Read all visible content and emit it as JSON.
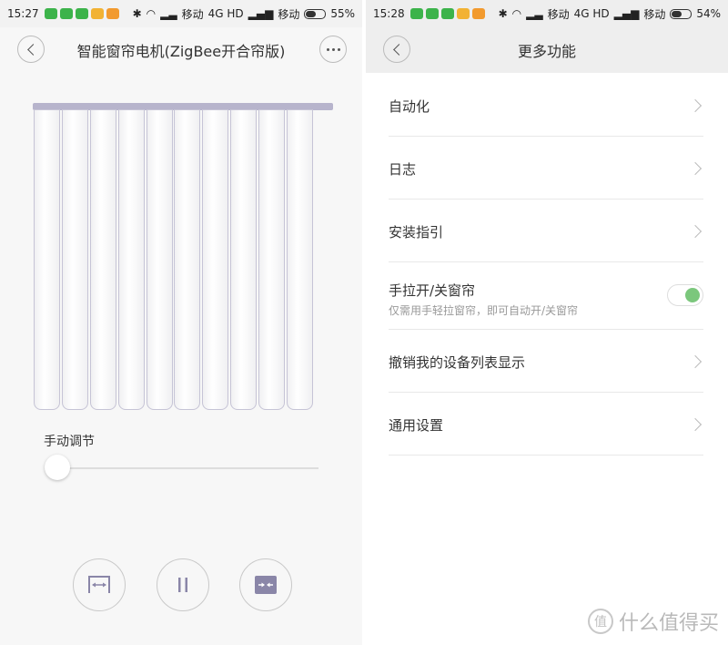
{
  "left": {
    "status_bar": {
      "time": "15:27",
      "carrier1": "移动",
      "network": "4G HD",
      "carrier2": "移动",
      "battery": "55%",
      "battery_level": 0.55
    },
    "nav": {
      "title": "智能窗帘电机(ZigBee开合帘版)"
    },
    "manual_label": "手动调节",
    "slider_value": 0
  },
  "right": {
    "status_bar": {
      "time": "15:28",
      "carrier1": "移动",
      "network": "4G HD",
      "carrier2": "移动",
      "battery": "54%",
      "battery_level": 0.54
    },
    "nav": {
      "title": "更多功能"
    },
    "menu": [
      {
        "label": "自动化"
      },
      {
        "label": "日志"
      },
      {
        "label": "安装指引"
      },
      {
        "label": "手拉开/关窗帘",
        "sub": "仅需用手轻拉窗帘，即可自动开/关窗帘",
        "toggle_on": true
      },
      {
        "label": "撤销我的设备列表显示"
      },
      {
        "label": "通用设置"
      }
    ]
  },
  "watermark": {
    "text": "什么值得买",
    "logo": "值"
  },
  "colors": {
    "accent_green": "#7bc77c",
    "curtain_stroke": "#c6c4d6",
    "rod": "#b7b4cc",
    "control_icon": "#8a86a8"
  }
}
